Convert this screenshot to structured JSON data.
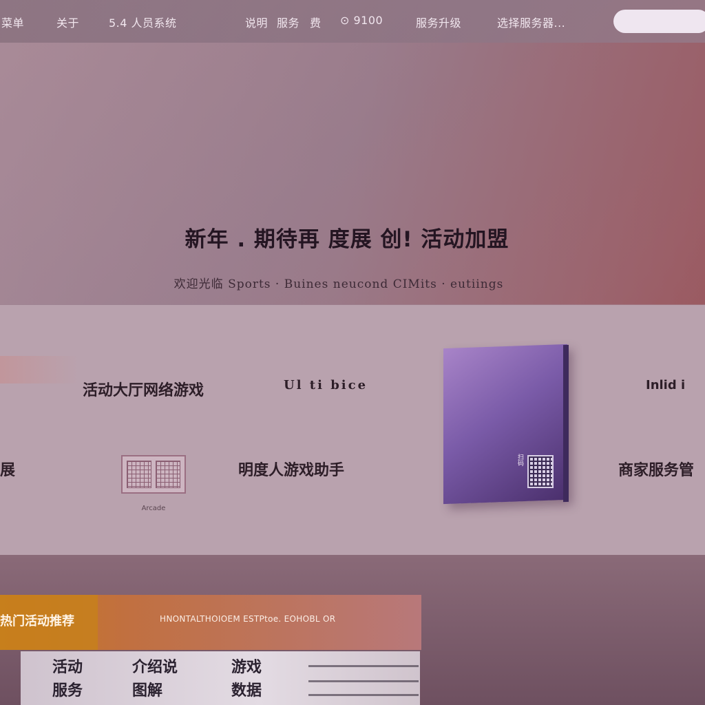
{
  "nav": {
    "items": [
      "菜单",
      "关于",
      "5.4 人员系统",
      "说明",
      "服务",
      "费",
      "⊙ 9100",
      "服务升级",
      "选择服务器..."
    ]
  },
  "search": {
    "placeholder": ""
  },
  "hero": {
    "title": "新年 . 期待再 度展 创! 活动加盟",
    "subtitle": "欢迎光临 Sports · Buines neucond  CIMits · eutiings"
  },
  "features": {
    "row1_left": "活动大厅网络游戏",
    "row1_mid": "Ul ti bice",
    "row1_right": "Inlid i",
    "row2_left": "展",
    "row2_mid": "明度人游戏助手",
    "row2_right": "商家服务管",
    "grid_caption": "Arcade"
  },
  "product": {
    "qr_label": "扫码"
  },
  "promo": {
    "label": "热门活动推荐",
    "text": "HNONTALTHOIOEM ESTPtoe. EOHOBL OR"
  },
  "doc": {
    "cells": [
      "活动",
      "介绍说",
      "游戏",
      "服务",
      "图解",
      "数据"
    ]
  },
  "colors": {
    "accent_orange": "#c7771e",
    "product_purple": "#7a5ba8",
    "band_bg": "#b9a2ae"
  }
}
